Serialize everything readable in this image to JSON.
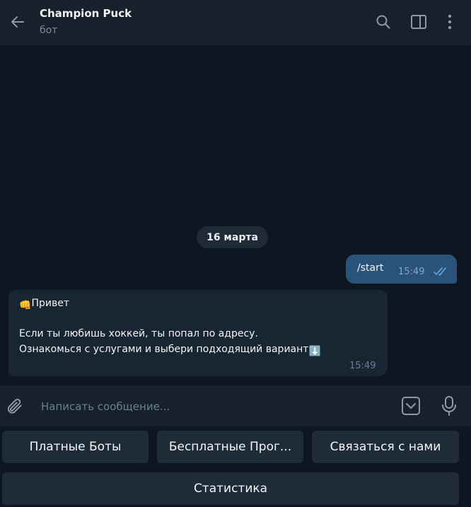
{
  "header": {
    "title": "Champion Puck",
    "subtitle": "бот",
    "back_icon": "arrow-left-icon",
    "search_icon": "search-icon",
    "sidebar_icon": "sidebar-panel-icon",
    "menu_icon": "more-vertical-icon"
  },
  "chat": {
    "date_separator": "16 марта",
    "outgoing": {
      "text": "/start",
      "time": "15:49",
      "status_icon": "double-check-icon"
    },
    "incoming": {
      "line1_emoji": "👊",
      "line1": "Привет",
      "line2": "Если ты любишь хоккей, ты попал по адресу.",
      "line3": "Ознакомься с услугами и выбери подходящий вариант",
      "line3_emoji": "⬇️",
      "time": "15:49"
    }
  },
  "composer": {
    "placeholder": "Написать сообщение...",
    "attach_icon": "paperclip-icon",
    "keyboard_icon": "bot-keyboard-icon",
    "mic_icon": "microphone-icon"
  },
  "bot_keyboard": {
    "buttons": [
      {
        "label": "Платные Боты"
      },
      {
        "label": "Бесплатные Прог..."
      },
      {
        "label": "Связаться с нами"
      },
      {
        "label": "Статистика"
      }
    ]
  },
  "colors": {
    "background": "#0e1621",
    "header": "#17212b",
    "outgoing_bubble": "#2b5278",
    "incoming_bubble": "#182533",
    "keyboard_button": "#1e2c3a",
    "check_color": "#5fa8e8"
  }
}
